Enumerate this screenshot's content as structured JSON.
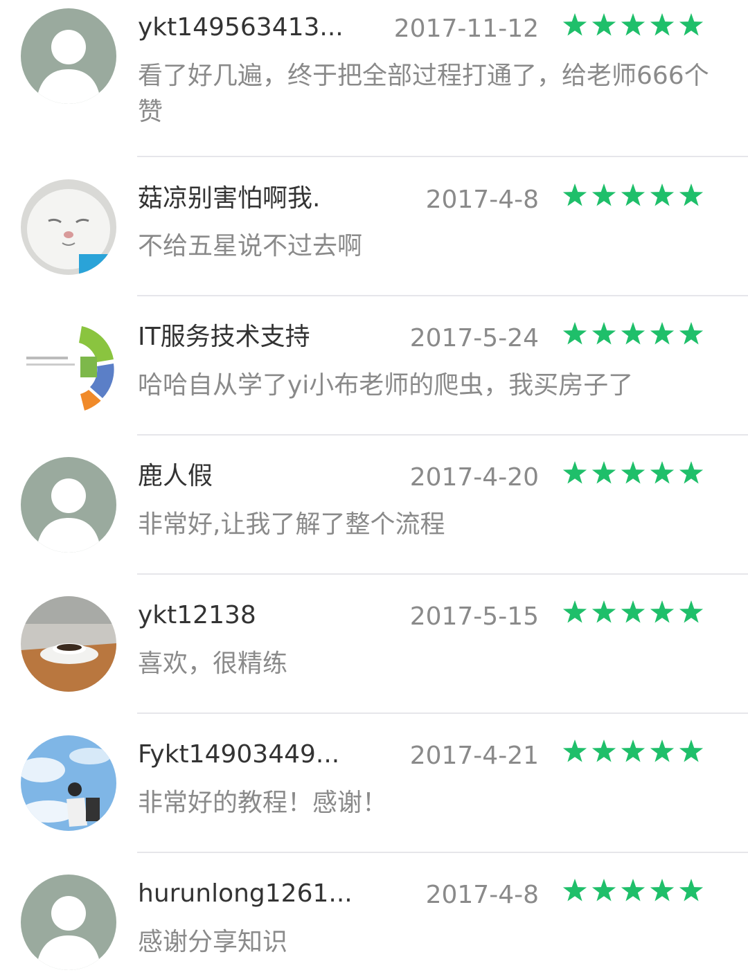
{
  "accent_color": "#1fbf6a",
  "star_icon": "star-icon",
  "reviews": [
    {
      "user": "ykt149563413...",
      "date": "2017-11-12",
      "rating": 5,
      "comment": "看了好几遍，终于把全部过程打通了，给老师666个赞",
      "avatar": "default-avatar-icon"
    },
    {
      "user": "菇凉别害怕啊我.",
      "date": "2017-4-8",
      "rating": 5,
      "comment": "不给五星说不过去啊",
      "avatar": "cat-photo-avatar"
    },
    {
      "user": "IT服务技术支持",
      "date": "2017-5-24",
      "rating": 5,
      "comment": "哈哈自从学了yi小布老师的爬虫，我买房子了",
      "avatar": "diagram-avatar"
    },
    {
      "user": "鹿人假",
      "date": "2017-4-20",
      "rating": 5,
      "comment": "非常好,让我了解了整个流程",
      "avatar": "default-avatar-icon"
    },
    {
      "user": "ykt12138",
      "date": "2017-5-15",
      "rating": 5,
      "comment": "喜欢，很精练",
      "avatar": "coffee-photo-avatar"
    },
    {
      "user": "Fykt14903449...",
      "date": "2017-4-21",
      "rating": 5,
      "comment": "非常好的教程！感谢！",
      "avatar": "sky-photo-avatar"
    },
    {
      "user": "hurunlong1261...",
      "date": "2017-4-8",
      "rating": 5,
      "comment": "感谢分享知识",
      "avatar": "default-avatar-icon"
    }
  ]
}
